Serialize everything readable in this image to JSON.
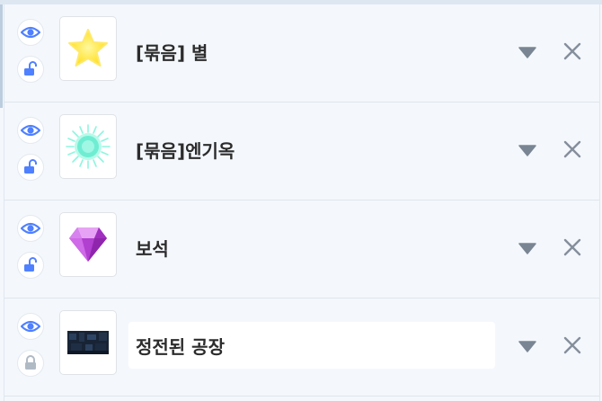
{
  "objects": [
    {
      "name": "[묶음] 별",
      "visible": true,
      "locked": false,
      "icon": "star-icon"
    },
    {
      "name": "[묶음]엔기옥",
      "visible": true,
      "locked": false,
      "icon": "energy-orb-icon"
    },
    {
      "name": "보석",
      "visible": true,
      "locked": false,
      "icon": "gem-icon"
    },
    {
      "name": "정전된 공장",
      "visible": true,
      "locked": true,
      "icon": "factory-scene-icon"
    }
  ],
  "colors": {
    "accent": "#4f80ff",
    "locked_icon": "#b0bac5",
    "dropdown_arrow": "#7a8593",
    "close_icon": "#858f9c",
    "star": "#ffe23a",
    "orb": "#74efd6",
    "gem": "#b93fd6"
  }
}
